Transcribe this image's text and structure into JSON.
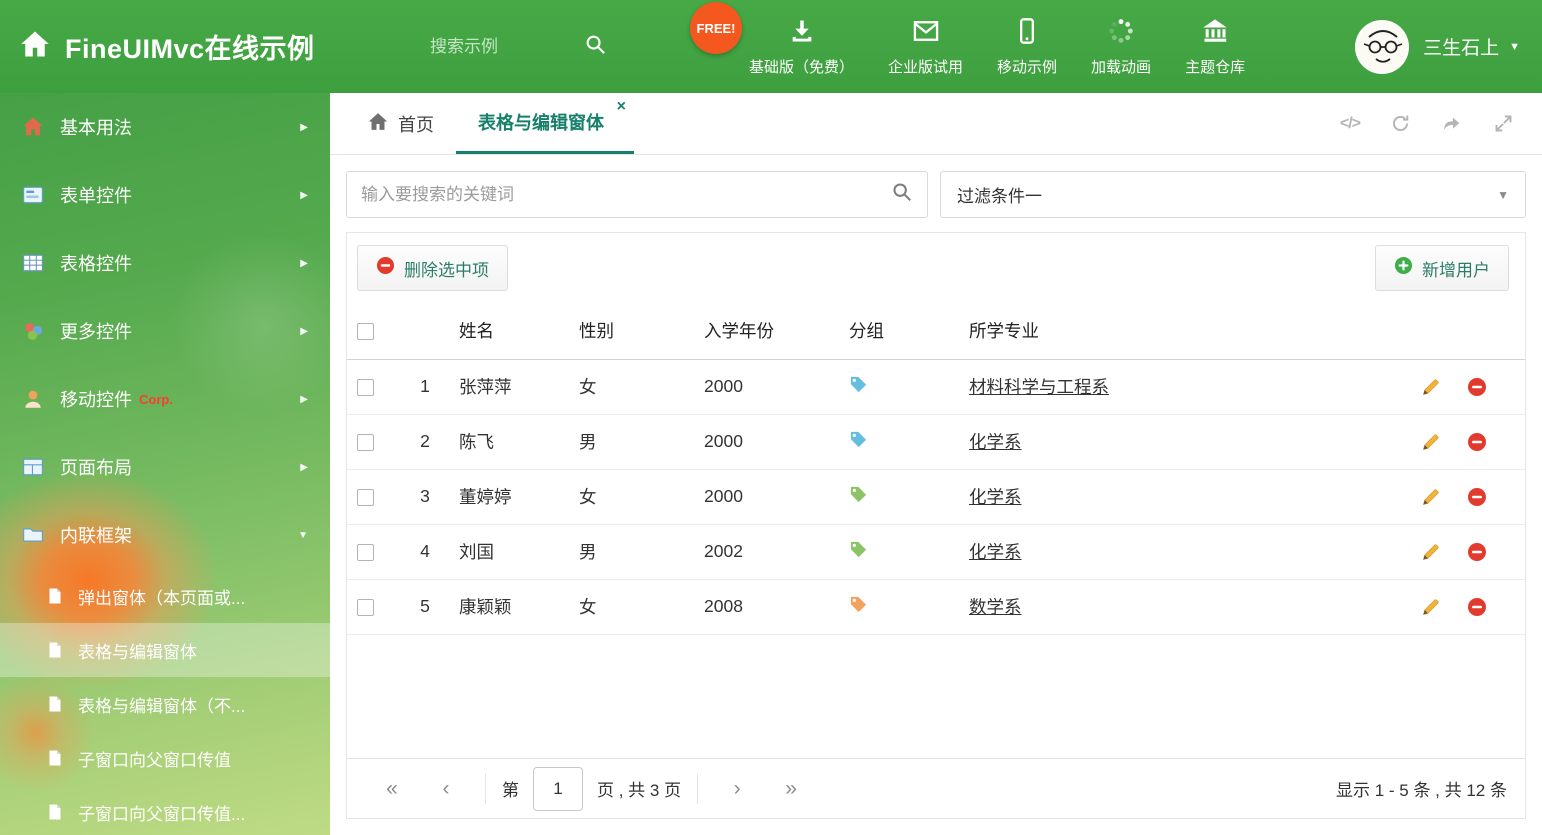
{
  "header": {
    "title": "FineUIMvc在线示例",
    "search_placeholder": "搜索示例",
    "free_badge": "FREE!",
    "nav_items": [
      {
        "label": "基础版（免费）"
      },
      {
        "label": "企业版试用"
      },
      {
        "label": "移动示例"
      },
      {
        "label": "加载动画"
      },
      {
        "label": "主题仓库"
      }
    ],
    "username": "三生石上"
  },
  "sidebar": {
    "items": [
      {
        "label": "基本用法"
      },
      {
        "label": "表单控件"
      },
      {
        "label": "表格控件"
      },
      {
        "label": "更多控件"
      },
      {
        "label": "移动控件",
        "badge": "Corp."
      },
      {
        "label": "页面布局"
      },
      {
        "label": "内联框架"
      }
    ],
    "subitems": [
      {
        "label": "弹出窗体（本页面或..."
      },
      {
        "label": "表格与编辑窗体"
      },
      {
        "label": "表格与编辑窗体（不..."
      },
      {
        "label": "子窗口向父窗口传值"
      },
      {
        "label": "子窗口向父窗口传值..."
      }
    ]
  },
  "tabs": {
    "home_label": "首页",
    "active_label": "表格与编辑窗体",
    "close_glyph": "×"
  },
  "filter_bar": {
    "search_placeholder": "输入要搜索的关键词",
    "filter_selected": "过滤条件一"
  },
  "grid": {
    "delete_button": "删除选中项",
    "add_button": "新增用户",
    "headers": {
      "name": "姓名",
      "gender": "性别",
      "year": "入学年份",
      "group": "分组",
      "major": "所学专业"
    },
    "rows": [
      {
        "index": "1",
        "name": "张萍萍",
        "gender": "女",
        "year": "2000",
        "tag_color": "#64bede",
        "major": "材料科学与工程系"
      },
      {
        "index": "2",
        "name": "陈飞",
        "gender": "男",
        "year": "2000",
        "tag_color": "#64bede",
        "major": "化学系"
      },
      {
        "index": "3",
        "name": "董婷婷",
        "gender": "女",
        "year": "2000",
        "tag_color": "#8cc368",
        "major": "化学系"
      },
      {
        "index": "4",
        "name": "刘国",
        "gender": "男",
        "year": "2002",
        "tag_color": "#8cc368",
        "major": "化学系"
      },
      {
        "index": "5",
        "name": "康颖颖",
        "gender": "女",
        "year": "2008",
        "tag_color": "#f2a35e",
        "major": "数学系"
      }
    ]
  },
  "pagination": {
    "first_glyph": "«",
    "prev_glyph": "‹",
    "next_glyph": "›",
    "last_glyph": "»",
    "page_prefix": "第",
    "page_value": "1",
    "page_suffix": "页 , 共 3 页",
    "summary": "显示 1 - 5 条 , 共 12 条"
  },
  "colors": {
    "header_green": "#42a442",
    "accent_teal": "#17806b",
    "danger_red": "#e23b2e",
    "success_green": "#3fae49"
  }
}
